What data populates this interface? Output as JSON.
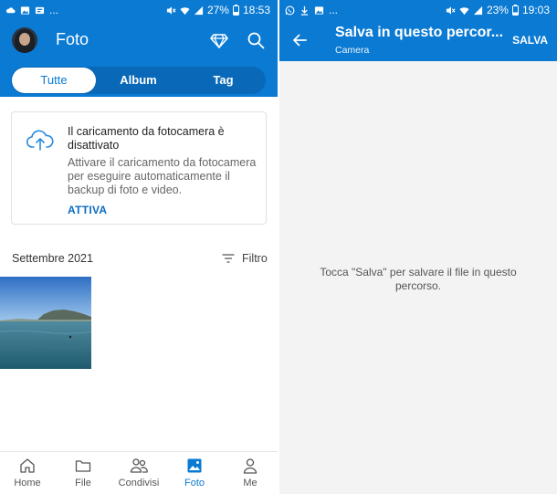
{
  "left": {
    "status_bar": {
      "left_icons": [
        "cloud-icon",
        "image-icon",
        "media-icon",
        "more-icon"
      ],
      "more_text": "...",
      "right_icons": [
        "mute-icon",
        "wifi-icon",
        "signal-icon"
      ],
      "battery": "27%",
      "time": "18:53"
    },
    "header": {
      "title": "Foto",
      "icons": [
        "premium-diamond-icon",
        "search-icon"
      ]
    },
    "tabs": [
      {
        "label": "Tutte",
        "active": true
      },
      {
        "label": "Album",
        "active": false
      },
      {
        "label": "Tag",
        "active": false
      }
    ],
    "camera_card": {
      "title": "Il caricamento da fotocamera è disattivato",
      "description": "Attivare il caricamento da fotocamera per eseguire automaticamente il backup di foto e video.",
      "action": "ATTIVA"
    },
    "section": {
      "date": "Settembre 2021",
      "filter": "Filtro"
    },
    "bottom_nav": [
      {
        "label": "Home",
        "icon": "home-icon",
        "active": false
      },
      {
        "label": "File",
        "icon": "folder-icon",
        "active": false
      },
      {
        "label": "Condivisi",
        "icon": "people-icon",
        "active": false
      },
      {
        "label": "Foto",
        "icon": "photo-icon",
        "active": true
      },
      {
        "label": "Me",
        "icon": "person-icon",
        "active": false
      }
    ]
  },
  "right": {
    "status_bar": {
      "left_icons": [
        "whatsapp-icon",
        "download-icon",
        "image-icon",
        "more-icon"
      ],
      "more_text": "...",
      "right_icons": [
        "mute-icon",
        "wifi-icon",
        "signal-icon"
      ],
      "battery": "23%",
      "time": "19:03"
    },
    "header": {
      "title": "Salva in questo percor...",
      "subtitle": "Camera",
      "action": "SALVA"
    },
    "empty_message": "Tocca \"Salva\" per salvare il file in questo percorso."
  },
  "colors": {
    "primary": "#0a7ad3",
    "tab_track": "#0a68b8",
    "link": "#0a6cc2",
    "background_right": "#f3f3f3"
  }
}
